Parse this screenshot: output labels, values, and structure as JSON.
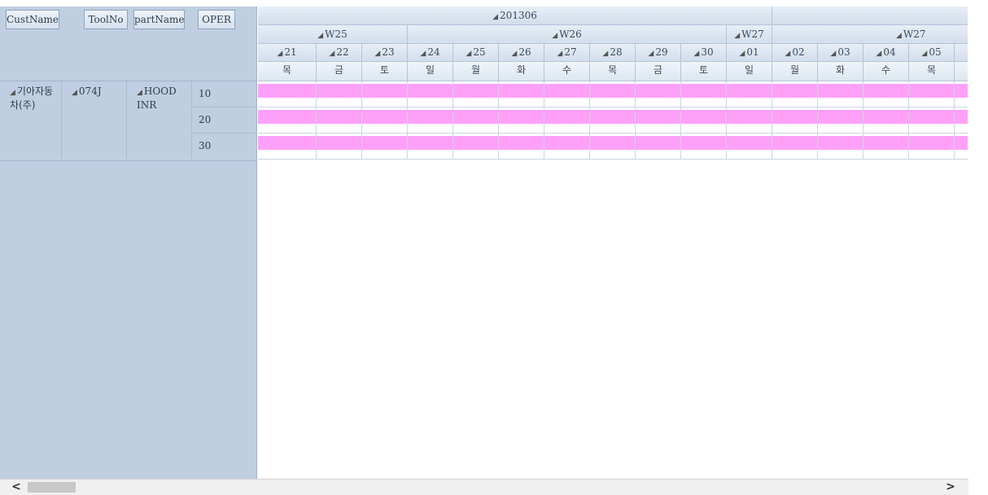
{
  "columns": {
    "cust_name": "CustName",
    "tool_no": "ToolNo",
    "part_name": "partName",
    "oper": "OPER"
  },
  "row_group": {
    "customer": "기아자동차(주)",
    "tool_no": "074J",
    "part_name": "HOOD INR",
    "opers": [
      "10",
      "20",
      "30"
    ]
  },
  "timeline": {
    "month": "201306",
    "weeks": [
      "W25",
      "W26",
      "W27",
      "W27"
    ],
    "days": [
      "21",
      "22",
      "23",
      "24",
      "25",
      "26",
      "27",
      "28",
      "29",
      "30",
      "01",
      "02",
      "03",
      "04",
      "05"
    ],
    "weekdays": [
      "목",
      "금",
      "토",
      "일",
      "월",
      "화",
      "수",
      "목",
      "금",
      "토",
      "일",
      "월",
      "화",
      "수",
      "목"
    ]
  },
  "colors": {
    "panel": "#bfcfe1",
    "bar": "#ffa0f8"
  },
  "scroll": {
    "left": "<",
    "right": ">"
  }
}
